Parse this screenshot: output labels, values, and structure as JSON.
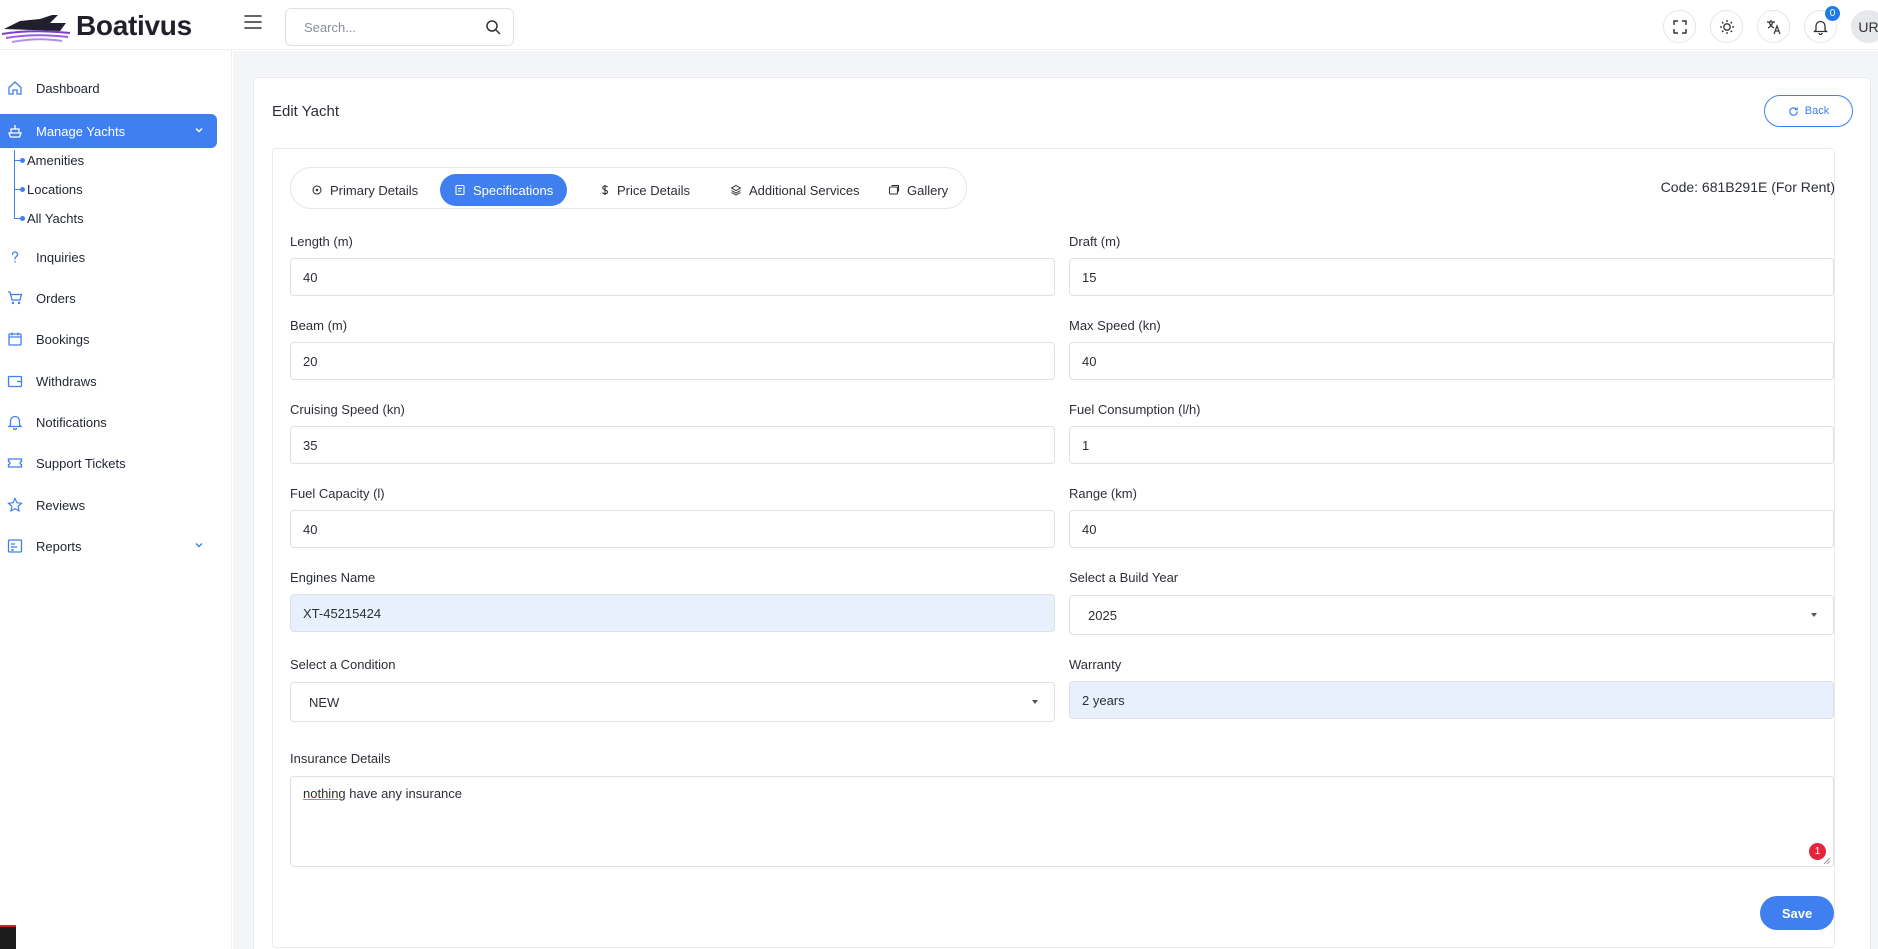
{
  "app": {
    "name": "Boativus"
  },
  "header": {
    "search_placeholder": "Search...",
    "notification_count": "0",
    "avatar_initials": "UR"
  },
  "sidebar": {
    "items": [
      {
        "label": "Dashboard",
        "icon": "home-icon"
      },
      {
        "label": "Manage Yachts",
        "icon": "ship-icon",
        "active": true
      },
      {
        "label": "Inquiries",
        "icon": "question-icon"
      },
      {
        "label": "Orders",
        "icon": "cart-icon"
      },
      {
        "label": "Bookings",
        "icon": "calendar-icon"
      },
      {
        "label": "Withdraws",
        "icon": "wallet-icon"
      },
      {
        "label": "Notifications",
        "icon": "bell-icon"
      },
      {
        "label": "Support Tickets",
        "icon": "ticket-icon"
      },
      {
        "label": "Reviews",
        "icon": "star-icon"
      },
      {
        "label": "Reports",
        "icon": "report-icon"
      }
    ],
    "sub_items": [
      {
        "label": "Amenities"
      },
      {
        "label": "Locations"
      },
      {
        "label": "All Yachts"
      }
    ]
  },
  "page": {
    "title": "Edit Yacht",
    "back_label": "Back",
    "code_text": "Code: 681B291E (For Rent)",
    "tabs": [
      {
        "label": "Primary Details"
      },
      {
        "label": "Specifications",
        "active": true
      },
      {
        "label": "Price Details"
      },
      {
        "label": "Additional Services"
      },
      {
        "label": "Gallery"
      }
    ]
  },
  "form": {
    "length": {
      "label": "Length (m)",
      "value": "40"
    },
    "draft": {
      "label": "Draft (m)",
      "value": "15"
    },
    "beam": {
      "label": "Beam (m)",
      "value": "20"
    },
    "max_speed": {
      "label": "Max Speed (kn)",
      "value": "40"
    },
    "cruising_speed": {
      "label": "Cruising Speed (kn)",
      "value": "35"
    },
    "fuel_consumption": {
      "label": "Fuel Consumption (l/h)",
      "value": "1"
    },
    "fuel_capacity": {
      "label": "Fuel Capacity (l)",
      "value": "40"
    },
    "range": {
      "label": "Range (km)",
      "value": "40"
    },
    "engines_name": {
      "label": "Engines Name",
      "value": "XT-45215424"
    },
    "build_year": {
      "label": "Select a Build Year",
      "value": "2025"
    },
    "condition": {
      "label": "Select a Condition",
      "value": "NEW"
    },
    "warranty": {
      "label": "Warranty",
      "value": "2 years"
    },
    "insurance": {
      "label": "Insurance Details",
      "value_misspelled": "nothing",
      "value_rest": " have any insurance",
      "error_count": "1"
    },
    "save_label": "Save"
  },
  "colors": {
    "accent": "#3f7ff0",
    "error": "#e5243b",
    "autofill": "#e8f0fe"
  }
}
